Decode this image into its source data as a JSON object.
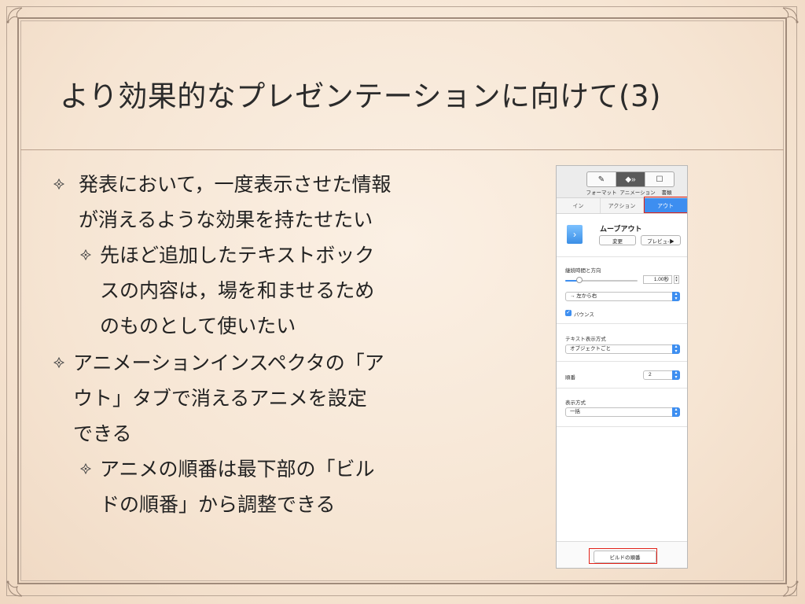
{
  "slide": {
    "title": "より効果的なプレゼンテーションに向けて(3)",
    "bullets": [
      {
        "level": 1,
        "lines": [
          "発表において，一度表示させた情報",
          "が消えるような効果を持たせたい"
        ]
      },
      {
        "level": 2,
        "lines": [
          "先ほど追加したテキストボック",
          "スの内容は，場を和ませるため",
          "のものとして使いたい"
        ]
      },
      {
        "level": 1,
        "lines": [
          "アニメーションインスペクタの「ア",
          "ウト」タブで消えるアニメを設定",
          "できる"
        ]
      },
      {
        "level": 2,
        "lines": [
          "アニメの順番は最下部の「ビル",
          "ドの順番」から調整できる"
        ]
      }
    ]
  },
  "inspector": {
    "segments": [
      {
        "label": "フォーマット",
        "icon": "paintbrush-icon"
      },
      {
        "label": "アニメーション",
        "icon": "diamond-arrows-icon"
      },
      {
        "label": "書類",
        "icon": "document-icon"
      }
    ],
    "tabs": [
      "イン",
      "アクション",
      "アウト"
    ],
    "active_tab": "アウト",
    "effect_name": "ムーブアウト",
    "change_button": "変更",
    "preview_button": "プレビュ-▶",
    "duration_label": "継続時間と方向",
    "duration_value": "1.00秒",
    "duration_level": 0.2,
    "direction_value": "→  左から右",
    "bounce_label": "バウンス",
    "bounce_checked": true,
    "text_delivery_label": "テキスト表示方式",
    "text_delivery_value": "オブジェクトごと",
    "order_label": "順番",
    "order_value": "2",
    "delivery_label": "表示方式",
    "delivery_value": "一括",
    "build_order_button": "ビルドの順番",
    "accent_color": "#3d8ef0",
    "highlight_color": "#e2231a"
  }
}
